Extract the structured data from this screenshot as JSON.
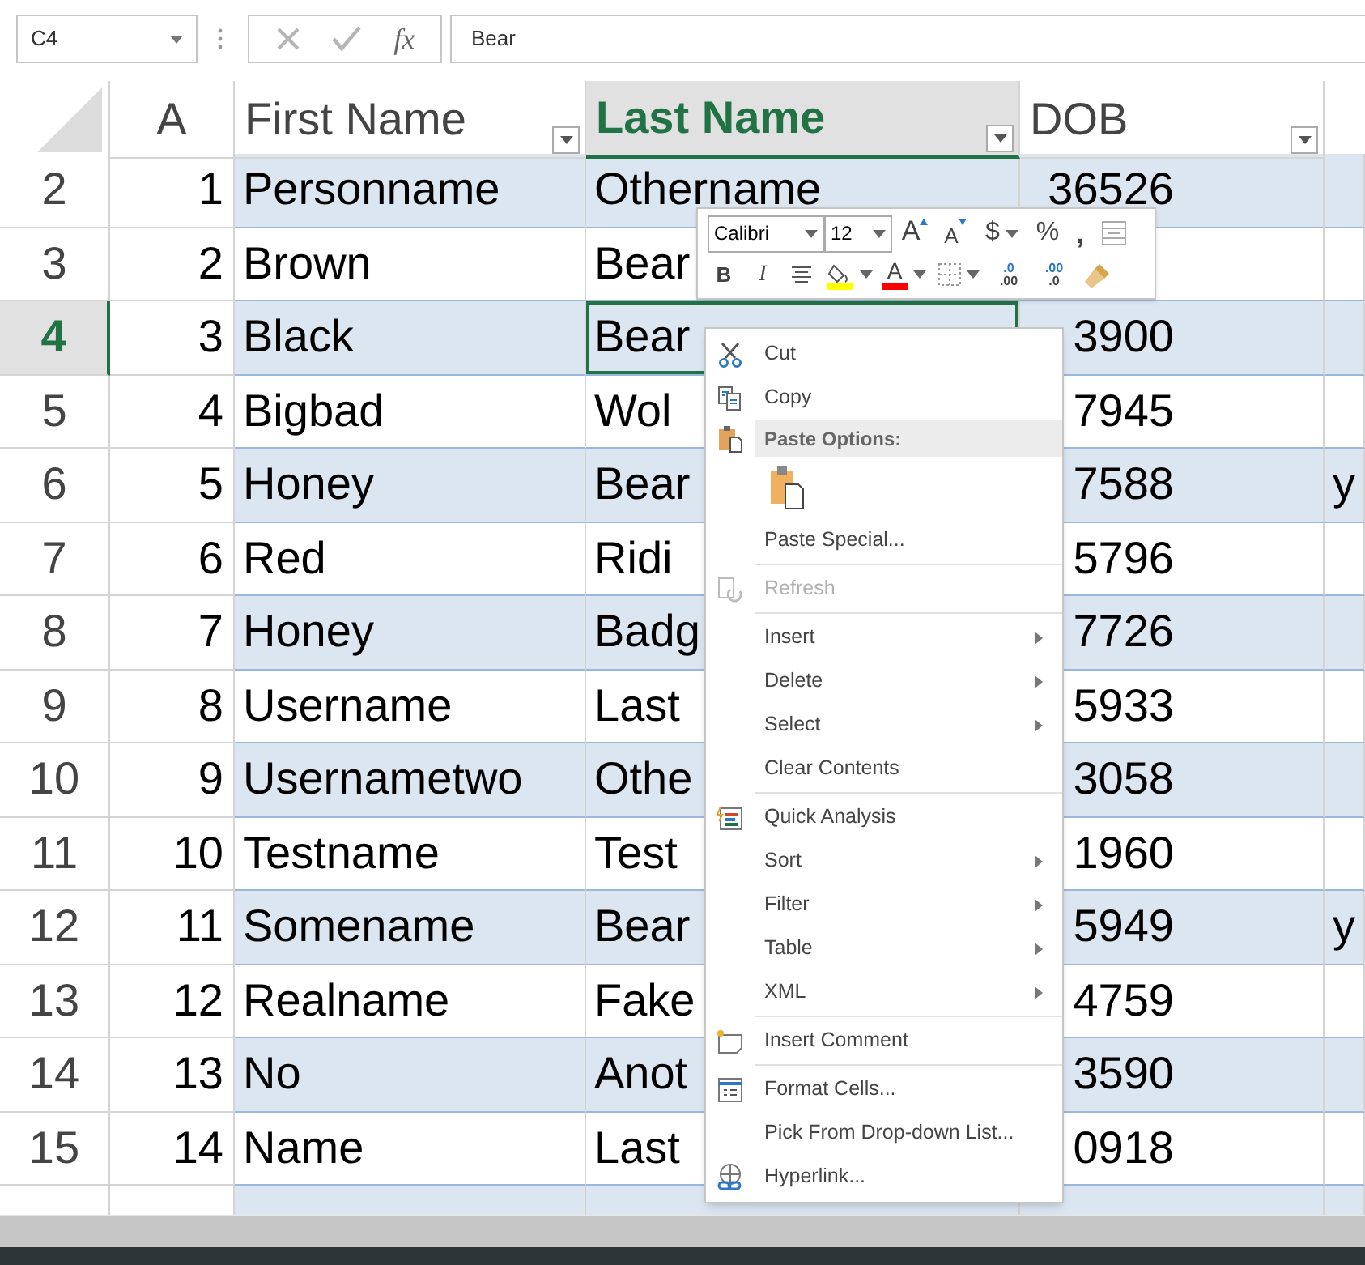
{
  "formula_bar": {
    "name_box": "C4",
    "function_label": "fx",
    "value": "Bear"
  },
  "columns": [
    {
      "label": "A",
      "selected": false,
      "filter": false
    },
    {
      "label": "First Name",
      "selected": false,
      "filter": true
    },
    {
      "label": "Last Name",
      "selected": true,
      "filter": true
    },
    {
      "label": "DOB",
      "selected": false,
      "filter": true
    }
  ],
  "rows": [
    {
      "header": "2",
      "selected": false,
      "cells": [
        "1",
        "Personname",
        "Othername",
        "36526"
      ]
    },
    {
      "header": "3",
      "selected": false,
      "cells": [
        "2",
        "Brown",
        "Bear"
      ]
    },
    {
      "header": "4",
      "selected": true,
      "cells": [
        "3",
        "Black",
        "Bear",
        "3900"
      ]
    },
    {
      "header": "5",
      "selected": false,
      "cells": [
        "4",
        "Bigbad",
        "Wol",
        "7945"
      ]
    },
    {
      "header": "6",
      "selected": false,
      "cells": [
        "5",
        "Honey",
        "Bear",
        "7588",
        "y"
      ]
    },
    {
      "header": "7",
      "selected": false,
      "cells": [
        "6",
        "Red",
        "Ridi",
        "5796"
      ]
    },
    {
      "header": "8",
      "selected": false,
      "cells": [
        "7",
        "Honey",
        "Badg",
        "7726"
      ]
    },
    {
      "header": "9",
      "selected": false,
      "cells": [
        "8",
        "Username",
        "Last",
        "5933"
      ]
    },
    {
      "header": "10",
      "selected": false,
      "cells": [
        "9",
        "Usernametwo",
        "Othe",
        "3058"
      ]
    },
    {
      "header": "11",
      "selected": false,
      "cells": [
        "10",
        "Testname",
        "Test",
        "1960"
      ]
    },
    {
      "header": "12",
      "selected": false,
      "cells": [
        "11",
        "Somename",
        "Bear",
        "5949",
        "y"
      ]
    },
    {
      "header": "13",
      "selected": false,
      "cells": [
        "12",
        "Realname",
        "Fake",
        "4759"
      ]
    },
    {
      "header": "14",
      "selected": false,
      "cells": [
        "13",
        "No",
        "Anot",
        "3590"
      ]
    },
    {
      "header": "15",
      "selected": false,
      "cells": [
        "14",
        "Name",
        "Last",
        "0918"
      ]
    }
  ],
  "mini_toolbar": {
    "font": "Calibri",
    "size": "12",
    "row_1": [
      {
        "kind": "grow",
        "label": "A"
      },
      {
        "kind": "shrink",
        "label": "A"
      },
      {
        "kind": "currency",
        "label": "$"
      },
      {
        "kind": "percent",
        "label": "%"
      },
      {
        "kind": "comma",
        "label": ","
      },
      {
        "kind": "merge"
      }
    ],
    "row_2": [
      {
        "kind": "bold",
        "label": "B"
      },
      {
        "kind": "italic",
        "label": "I"
      },
      {
        "kind": "center"
      },
      {
        "kind": "fill",
        "color": "#ffff00"
      },
      {
        "kind": "font_color",
        "label": "A",
        "color": "#ff0000"
      },
      {
        "kind": "borders"
      },
      {
        "kind": "increase_decimal",
        "label": ".0",
        "label_2": ".00"
      },
      {
        "kind": "decrease_decimal",
        "label": ".00",
        "label_2": ".0"
      },
      {
        "kind": "format_painter"
      }
    ]
  },
  "context_menu": [
    {
      "kind": "item",
      "label": "Cut",
      "disabled": false,
      "submenu": false
    },
    {
      "kind": "item",
      "label": "Copy",
      "disabled": false,
      "submenu": false
    },
    {
      "kind": "header",
      "label": "Paste Options:"
    },
    {
      "kind": "paste_options"
    },
    {
      "kind": "item",
      "label": "Paste Special...",
      "disabled": false,
      "submenu": false
    },
    {
      "kind": "separator"
    },
    {
      "kind": "item",
      "label": "Refresh",
      "disabled": true,
      "submenu": false
    },
    {
      "kind": "separator"
    },
    {
      "kind": "item",
      "label": "Insert",
      "disabled": false,
      "submenu": true
    },
    {
      "kind": "item",
      "label": "Delete",
      "disabled": false,
      "submenu": true
    },
    {
      "kind": "item",
      "label": "Select",
      "disabled": false,
      "submenu": true
    },
    {
      "kind": "item",
      "label": "Clear Contents",
      "disabled": false,
      "submenu": false
    },
    {
      "kind": "separator"
    },
    {
      "kind": "item",
      "label": "Quick Analysis",
      "disabled": false,
      "submenu": false
    },
    {
      "kind": "item",
      "label": "Sort",
      "disabled": false,
      "submenu": true
    },
    {
      "kind": "item",
      "label": "Filter",
      "disabled": false,
      "submenu": true
    },
    {
      "kind": "item",
      "label": "Table",
      "disabled": false,
      "submenu": true
    },
    {
      "kind": "item",
      "label": "XML",
      "disabled": false,
      "submenu": true
    },
    {
      "kind": "separator"
    },
    {
      "kind": "item",
      "label": "Insert Comment",
      "disabled": false,
      "submenu": false
    },
    {
      "kind": "separator"
    },
    {
      "kind": "item",
      "label": "Format Cells...",
      "disabled": false,
      "submenu": false
    },
    {
      "kind": "item",
      "label": "Pick From Drop-down List...",
      "disabled": false,
      "submenu": false
    },
    {
      "kind": "item",
      "label": "Hyperlink...",
      "disabled": false,
      "submenu": false
    }
  ]
}
